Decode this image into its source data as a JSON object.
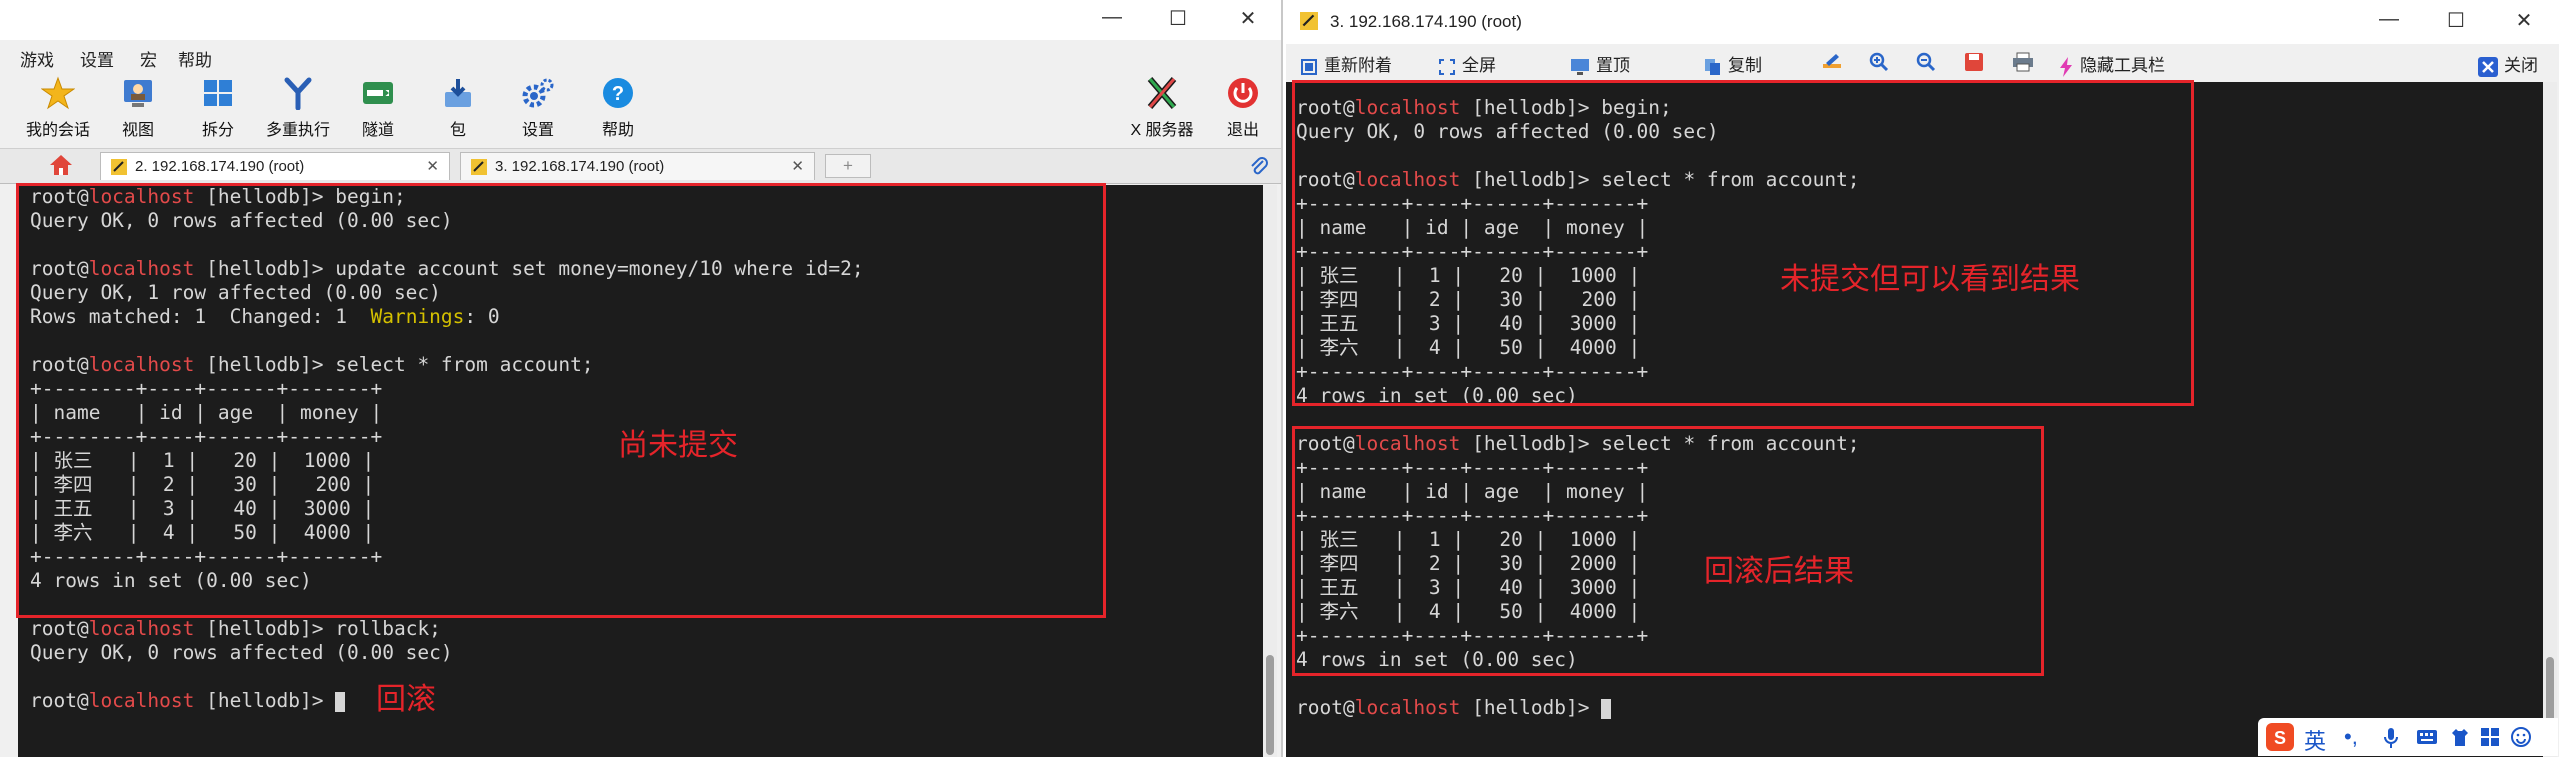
{
  "left_window": {
    "menu": [
      "游戏",
      "设置",
      "宏",
      "帮助"
    ],
    "toolbar": [
      "我的会话",
      "视图",
      "拆分",
      "多重执行",
      "隧道",
      "包",
      "设置",
      "帮助",
      "X 服务器",
      "退出"
    ],
    "tabs": [
      {
        "label": "2. 192.168.174.190 (root)",
        "active": true
      },
      {
        "label": "3. 192.168.174.190 (root)",
        "active": false
      }
    ],
    "terminal": {
      "prompt_user": "root@",
      "prompt_host": "localhost",
      "prompt_db": " [hellodb]> ",
      "cmd_begin": "begin;",
      "out_begin": "Query OK, 0 rows affected (0.00 sec)",
      "cmd_update": "update account set money=money/10 where id=2;",
      "out_update1": "Query OK, 1 row affected (0.00 sec)",
      "out_update2a": "Rows matched: 1  Changed: 1  ",
      "out_update2b": "Warnings",
      "out_update2c": ": 0",
      "cmd_select": "select * from account;",
      "border": "+--------+----+------+-------+",
      "header": "| name   | id | age  | money |",
      "rows": [
        "| 张三   |  1 |   20 |  1000 |",
        "| 李四   |  2 |   30 |   200 |",
        "| 王五   |  3 |   40 |  3000 |",
        "| 李六   |  4 |   50 |  4000 |"
      ],
      "rows_summary": "4 rows in set (0.00 sec)",
      "cmd_rollback": "rollback;",
      "out_rollback": "Query OK, 0 rows affected (0.00 sec)"
    },
    "notes": {
      "uncommitted": "尚未提交",
      "rollback": "回滚"
    }
  },
  "right_window": {
    "title": "3. 192.168.174.190 (root)",
    "toolbar": [
      "重新附着",
      "全屏",
      "置顶",
      "复制",
      "隐藏工具栏",
      "关闭"
    ],
    "terminal": {
      "prompt_user": "root@",
      "prompt_host": "localhost",
      "prompt_db": " [hellodb]> ",
      "cmd_begin": "begin;",
      "out_begin": "Query OK, 0 rows affected (0.00 sec)",
      "cmd_select": "select * from account;",
      "border": "+--------+----+------+-------+",
      "header": "| name   | id | age  | money |",
      "rows1": [
        "| 张三   |  1 |   20 |  1000 |",
        "| 李四   |  2 |   30 |   200 |",
        "| 王五   |  3 |   40 |  3000 |",
        "| 李六   |  4 |   50 |  4000 |"
      ],
      "rows2": [
        "| 张三   |  1 |   20 |  1000 |",
        "| 李四   |  2 |   30 |  2000 |",
        "| 王五   |  3 |   40 |  3000 |",
        "| 李六   |  4 |   50 |  4000 |"
      ],
      "rows_summary": "4 rows in set (0.00 sec)"
    },
    "notes": {
      "uncommitted_visible": "未提交但可以看到结果",
      "after_rollback": "回滚后结果"
    }
  },
  "ime": {
    "mode": "英",
    "punct": "•,"
  },
  "colors": {
    "terminal_bg": "#1c1c1c",
    "terminal_fg": "#d6d6d6",
    "host": "#e34a4a",
    "warning": "#d4c000",
    "annotation": "#e5242a"
  }
}
